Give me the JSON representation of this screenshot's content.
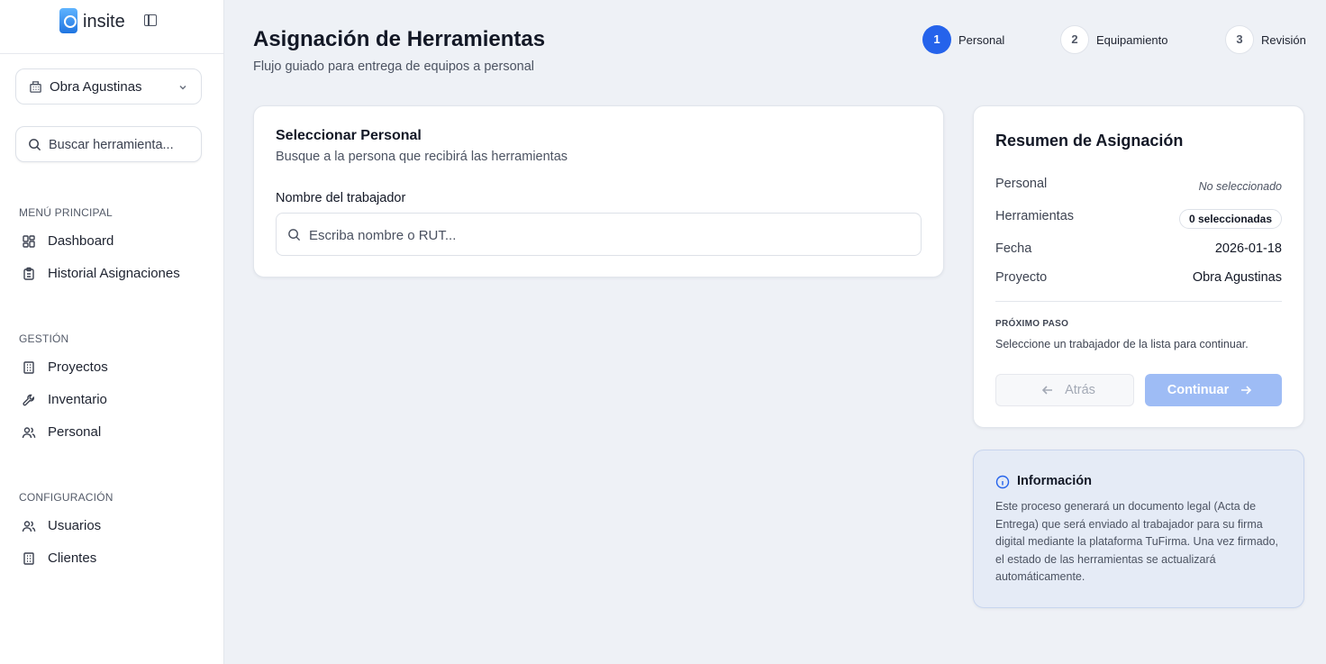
{
  "brand": {
    "name": "insite"
  },
  "sidebar": {
    "project": "Obra Agustinas",
    "search_placeholder": "Buscar herramienta...",
    "sections": [
      {
        "title": "MENÚ PRINCIPAL",
        "items": [
          {
            "label": "Dashboard",
            "icon": "dashboard-icon"
          },
          {
            "label": "Historial Asignaciones",
            "icon": "clipboard-icon"
          }
        ]
      },
      {
        "title": "GESTIÓN",
        "items": [
          {
            "label": "Proyectos",
            "icon": "building-icon"
          },
          {
            "label": "Inventario",
            "icon": "wrench-icon"
          },
          {
            "label": "Personal",
            "icon": "users-icon"
          }
        ]
      },
      {
        "title": "CONFIGURACIÓN",
        "items": [
          {
            "label": "Usuarios",
            "icon": "users-icon"
          },
          {
            "label": "Clientes",
            "icon": "building-icon"
          }
        ]
      }
    ]
  },
  "header": {
    "title": "Asignación de Herramientas",
    "subtitle": "Flujo guiado para entrega de equipos a personal",
    "steps": [
      {
        "number": "1",
        "label": "Personal",
        "active": true
      },
      {
        "number": "2",
        "label": "Equipamiento",
        "active": false
      },
      {
        "number": "3",
        "label": "Revisión",
        "active": false
      }
    ]
  },
  "select_card": {
    "title": "Seleccionar Personal",
    "subtitle": "Busque a la persona que recibirá las herramientas",
    "field_label": "Nombre del trabajador",
    "field_placeholder": "Escriba nombre o RUT..."
  },
  "summary": {
    "title": "Resumen de Asignación",
    "rows": {
      "personal": {
        "key": "Personal",
        "value": "No seleccionado"
      },
      "herramientas": {
        "key": "Herramientas",
        "value": "0 seleccionadas"
      },
      "fecha": {
        "key": "Fecha",
        "value": "2026-01-18"
      },
      "proyecto": {
        "key": "Proyecto",
        "value": "Obra Agustinas"
      }
    },
    "next_step_title": "PRÓXIMO PASO",
    "next_step_text": "Seleccione un trabajador de la lista para continuar.",
    "back_label": "Atrás",
    "continue_label": "Continuar"
  },
  "info": {
    "title": "Información",
    "body": "Este proceso generará un documento legal (Acta de Entrega) que será enviado al trabajador para su firma digital mediante la plataforma TuFirma. Una vez firmado, el estado de las herramientas se actualizará automáticamente."
  },
  "colors": {
    "accent": "#2563eb",
    "accent_disabled": "#9ebcf5",
    "info_bg": "#e5ebf6"
  }
}
